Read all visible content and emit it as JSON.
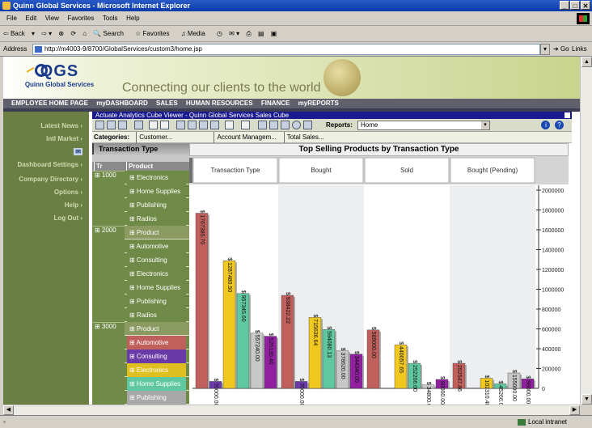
{
  "window": {
    "title": "Quinn Global Services - Microsoft Internet Explorer"
  },
  "menu": [
    "File",
    "Edit",
    "View",
    "Favorites",
    "Tools",
    "Help"
  ],
  "toolbar": {
    "back": "Back",
    "search": "Search",
    "favorites": "Favorites",
    "media": "Media"
  },
  "address": {
    "label": "Address",
    "url": "http://m4003-9/8700/GlobalServices/custom3/home.jsp",
    "go": "Go",
    "links": "Links"
  },
  "header": {
    "logo_big": "QGS",
    "logo_small": "Quinn Global Services",
    "slogan": "Connecting our clients to the world"
  },
  "nav": [
    "EMPLOYEE HOME PAGE",
    "myDASHBOARD",
    "SALES",
    "HUMAN RESOURCES",
    "FINANCE",
    "myREPORTS"
  ],
  "sidebar": [
    "Latest News",
    "Intl Market",
    "Dashboard Settings",
    "Company Directory",
    "Options",
    "Help",
    "Log Out"
  ],
  "cube": {
    "title": "Actuate Analytics Cube Viewer - Quinn Global Services Sales Cube",
    "reports_label": "Reports:",
    "reports_value": "Home",
    "categories_label": "Categories:",
    "categories": [
      "Customer...",
      "Account Managem...",
      "Total Sales..."
    ],
    "pivot_header": "Transaction Type",
    "col_tr": "Tr",
    "col_product": "Product"
  },
  "pivot_rows": [
    {
      "tt": "1000",
      "label": "Electronics",
      "cat": false,
      "color": "#6f8a47"
    },
    {
      "tt": "",
      "label": "Home Supplies",
      "cat": false,
      "color": "#6f8a47"
    },
    {
      "tt": "",
      "label": "Publishing",
      "cat": false,
      "color": "#6f8a47"
    },
    {
      "tt": "",
      "label": "Radios",
      "cat": false,
      "color": "#6f8a47"
    },
    {
      "tt": "2000",
      "label": "Product",
      "cat": true,
      "color": "#8a9a60"
    },
    {
      "tt": "",
      "label": "Automotive",
      "cat": false,
      "color": "#6f8a47"
    },
    {
      "tt": "",
      "label": "Consulting",
      "cat": false,
      "color": "#6f8a47"
    },
    {
      "tt": "",
      "label": "Electronics",
      "cat": false,
      "color": "#6f8a47"
    },
    {
      "tt": "",
      "label": "Home Supplies",
      "cat": false,
      "color": "#6f8a47"
    },
    {
      "tt": "",
      "label": "Publishing",
      "cat": false,
      "color": "#6f8a47"
    },
    {
      "tt": "",
      "label": "Radios",
      "cat": false,
      "color": "#6f8a47"
    },
    {
      "tt": "3000",
      "label": "Product",
      "cat": true,
      "color": "#8a9a60"
    },
    {
      "tt": "",
      "label": "Automotive",
      "cat": false,
      "color": "#c0605c"
    },
    {
      "tt": "",
      "label": "Consulting",
      "cat": false,
      "color": "#6a3aa8"
    },
    {
      "tt": "",
      "label": "Electronics",
      "cat": false,
      "color": "#e0c020"
    },
    {
      "tt": "",
      "label": "Home Supplies",
      "cat": false,
      "color": "#60c8a0"
    },
    {
      "tt": "",
      "label": "Publishing",
      "cat": false,
      "color": "#a8a8a8"
    },
    {
      "tt": "",
      "label": "Radios",
      "cat": false,
      "color": "#9020a0"
    }
  ],
  "status": {
    "zone": "Local intranet"
  },
  "chart_data": {
    "type": "bar",
    "title": "Top Selling Products by Transaction Type",
    "x_header": "Transaction Type",
    "categories": [
      "Bought",
      "Sold",
      "Bought (Pending)"
    ],
    "first_group": "Transaction Type",
    "ylim": [
      0,
      2000000
    ],
    "yticks": [
      200000,
      400000,
      600000,
      800000,
      1000000,
      1200000,
      1400000,
      1600000,
      1800000,
      2000000
    ],
    "series": [
      {
        "name": "Automotive",
        "color": "#c0605c",
        "values": [
          1767385,
          938422,
          589000,
          252547
        ]
      },
      {
        "name": "Consulting",
        "color": "#6a3aa8",
        "values": [
          70000,
          70000,
          0,
          0
        ]
      },
      {
        "name": "Electronics",
        "color": "#f0c820",
        "values": [
          1287480,
          715636,
          440057,
          102310
        ]
      },
      {
        "name": "Home Supplies",
        "color": "#60c8a0",
        "values": [
          957345,
          594080,
          252206,
          45266
        ]
      },
      {
        "name": "Publishing",
        "color": "#c8c8c8",
        "values": [
          557240,
          378620,
          34800,
          155000
        ]
      },
      {
        "name": "Radios",
        "color": "#9020a0",
        "values": [
          526130,
          344340,
          90000,
          96000
        ]
      }
    ],
    "value_labels": [
      [
        "$ 1767385.70",
        "$ 70000.00",
        "$ 1287480.50",
        "$ 957345.60",
        "$ 557240.00",
        "$ 526130.40"
      ],
      [
        "$ 938422.22",
        "$ 70000.00",
        "$ 715636.64",
        "$ 594080.13",
        "$ 378620.00",
        "$ 344340.00"
      ],
      [
        "$ 589000.00",
        "",
        "$ 440057.65",
        "$ 252206.00",
        "$ 34800.00",
        "$ 90000.00"
      ],
      [
        "$ 252547.86",
        "",
        "$ 102310.40",
        "$ 45266.00",
        "$ 155000.00",
        "$ 96000.00"
      ]
    ]
  }
}
